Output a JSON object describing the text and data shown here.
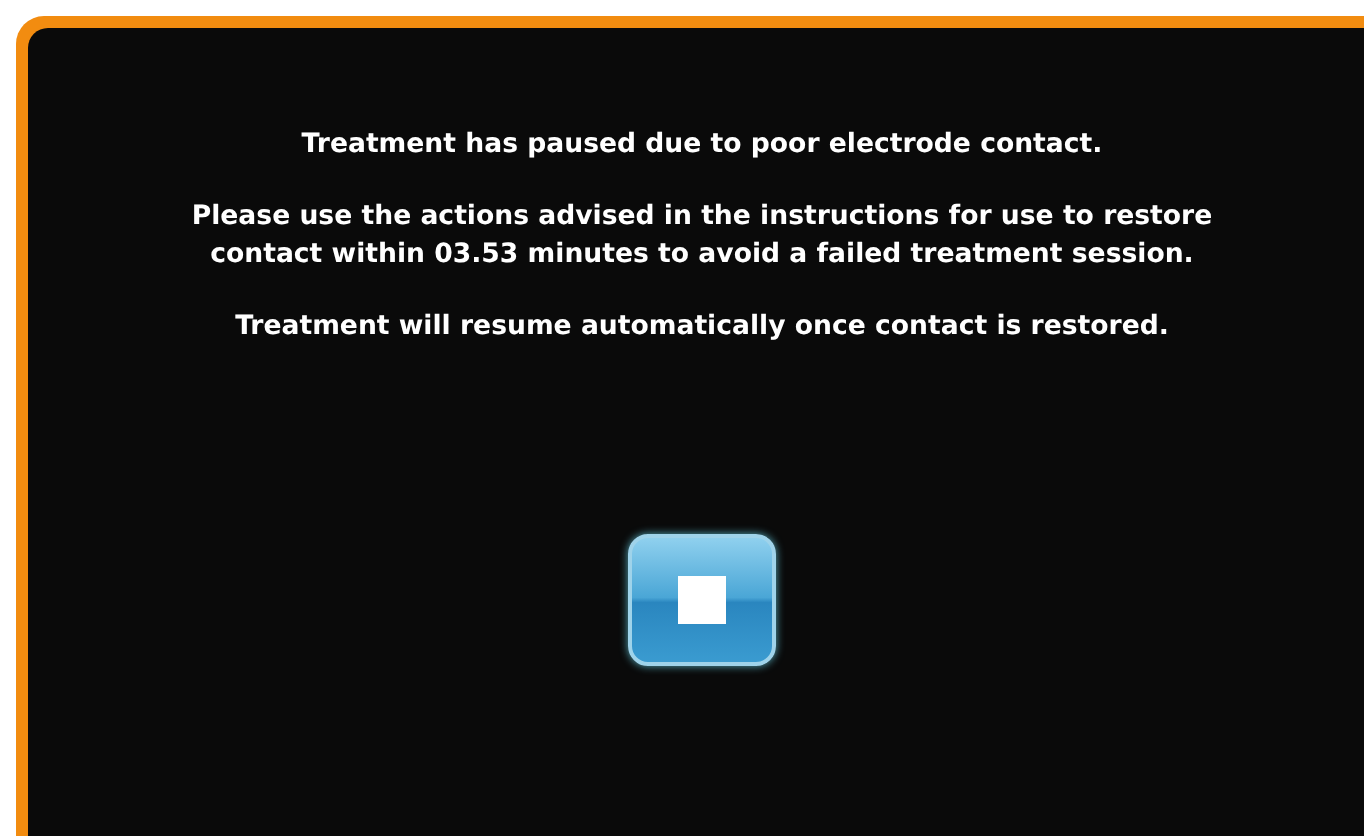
{
  "messages": [
    "Treatment has paused due to poor electrode contact.",
    "Please use the actions advised in the instructions for use to restore contact within 03.53 minutes to avoid a failed treatment session.",
    "Treatment will resume automatically once contact is restored."
  ]
}
